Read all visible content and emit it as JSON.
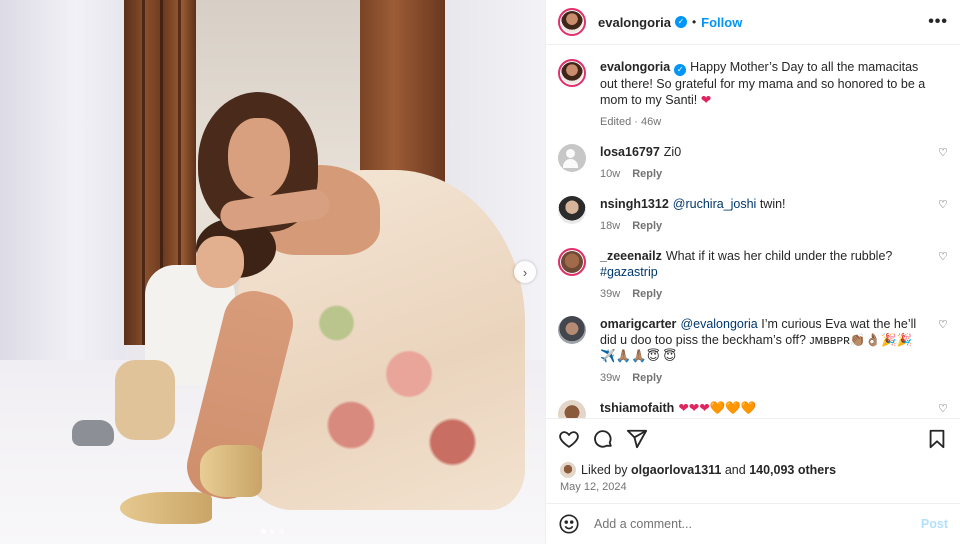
{
  "post": {
    "username": "evalongoria",
    "follow_label": "Follow",
    "dot": "•",
    "more_label": "•••",
    "caption": {
      "username": "evalongoria",
      "text": "Happy Mother’s Day to all the mamacitas out there! So grateful for my mama and so honored to be a mom to my Santi!",
      "emoji": "❤",
      "edited": "Edited · 46w"
    },
    "carousel": {
      "next_icon": "chevron-right-icon",
      "dots": 3,
      "active_dot": 1
    }
  },
  "comments": [
    {
      "username": "losa16797",
      "pre": "",
      "mention": "",
      "text": "Zi0",
      "age": "10w",
      "reply": "Reply",
      "avatar": "default"
    },
    {
      "username": "nsingh1312",
      "pre": "",
      "mention": "@ruchira_joshi",
      "text": " twin!",
      "age": "18w",
      "reply": "Reply",
      "avatar": "a2"
    },
    {
      "username": "_zeeenailz",
      "pre": "What if it was her child under the rubble? ",
      "mention": "#gazastrip",
      "text": "",
      "age": "39w",
      "reply": "Reply",
      "avatar": "a3"
    },
    {
      "username": "omarigcarter",
      "pre": "",
      "mention": "@evalongoria",
      "text": " I’m curious Eva wat the he’ll did u doo too piss the beckham’s off? ᴊᴍʙʙᴘʀ👏🏽👌🏽🎉🎉✈️🙏🏽🙏🏽😇 😇",
      "age": "39w",
      "reply": "Reply",
      "avatar": "a4"
    },
    {
      "username": "tshiamofaith",
      "pre": "",
      "mention": "",
      "text": "❤❤❤🧡🧡🧡",
      "age": "",
      "reply": "",
      "avatar": "a5"
    }
  ],
  "likes": {
    "prefix": "Liked by ",
    "user": "olgaorlova1311",
    "middle": " and ",
    "count": "140,093 others"
  },
  "date": "May 12, 2024",
  "add_comment": {
    "placeholder": "Add a comment...",
    "post_label": "Post"
  },
  "colors": {
    "link": "#0095f6",
    "mention": "#00376b",
    "muted": "#737373",
    "verified": "#0095f6",
    "post_disabled": "#b2dffc"
  }
}
